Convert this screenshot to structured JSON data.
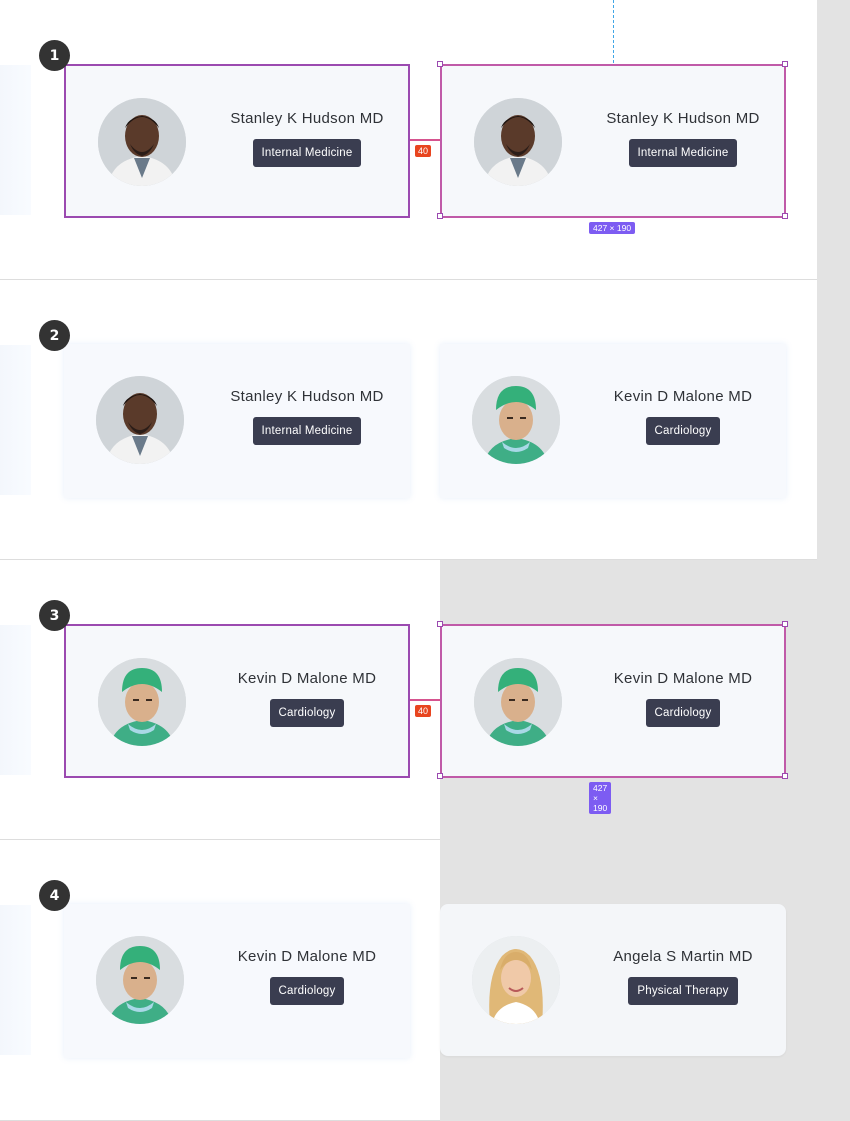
{
  "steps": [
    "1",
    "2",
    "3",
    "4"
  ],
  "doctors": {
    "stanley": {
      "name": "Stanley K Hudson MD",
      "specialty": "Internal Medicine"
    },
    "kevin": {
      "name": "Kevin D Malone MD",
      "specialty": "Cardiology"
    },
    "angela": {
      "name": "Angela S Martin MD",
      "specialty": "Physical Therapy"
    }
  },
  "measurements": {
    "gap": "40",
    "size": "427 × 190"
  },
  "colors": {
    "selection": "#9b4ab0",
    "badge_bg": "#3a3d50",
    "gap_badge": "#e8451f",
    "dim_badge": "#7d5cf2",
    "guide": "#40a6e6"
  },
  "icons": [
    "doctor-avatar",
    "surgeon-avatar",
    "therapist-avatar"
  ]
}
